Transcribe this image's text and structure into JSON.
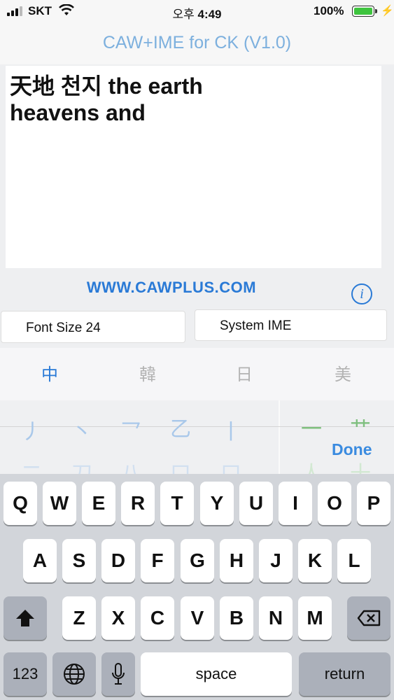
{
  "status_bar": {
    "carrier": "SKT",
    "time_prefix": "오후",
    "time": "4:49",
    "battery_percent": "100%",
    "battery_level": 1.0,
    "icons": [
      "signal-icon",
      "wifi-icon",
      "battery-icon",
      "charging-bolt-icon"
    ]
  },
  "nav": {
    "title": "CAW+IME for CK (V1.0)"
  },
  "editor": {
    "text": "天地 천지 the earth\nheavens and"
  },
  "website": "WWW.CAWPLUS.COM",
  "buttons": {
    "font_size": "Font Size 24",
    "system_ime": "System IME",
    "info_icon": "i"
  },
  "lang_tabs": [
    {
      "label": "中",
      "active": true
    },
    {
      "label": "韓",
      "active": false
    },
    {
      "label": "日",
      "active": false
    },
    {
      "label": "美",
      "active": false
    }
  ],
  "stroke_keys": {
    "row1": [
      "丿",
      "丶",
      "乛",
      "乙",
      "丨"
    ],
    "row1_right": [
      "一",
      "艹"
    ],
    "row2": [
      "二",
      "刀",
      "八",
      "口",
      "口"
    ],
    "row2_right": [
      "人",
      "十"
    ]
  },
  "done_label": "Done",
  "keyboard": {
    "row1": [
      "Q",
      "W",
      "E",
      "R",
      "T",
      "Y",
      "U",
      "I",
      "O",
      "P"
    ],
    "row2": [
      "A",
      "S",
      "D",
      "F",
      "G",
      "H",
      "J",
      "K",
      "L"
    ],
    "row3": [
      "Z",
      "X",
      "C",
      "V",
      "B",
      "N",
      "M"
    ],
    "numbers_label": "123",
    "space_label": "space",
    "return_label": "return"
  },
  "colors": {
    "accent": "#2a7ad6",
    "title": "#7db0de",
    "battery": "#3ec43e"
  }
}
